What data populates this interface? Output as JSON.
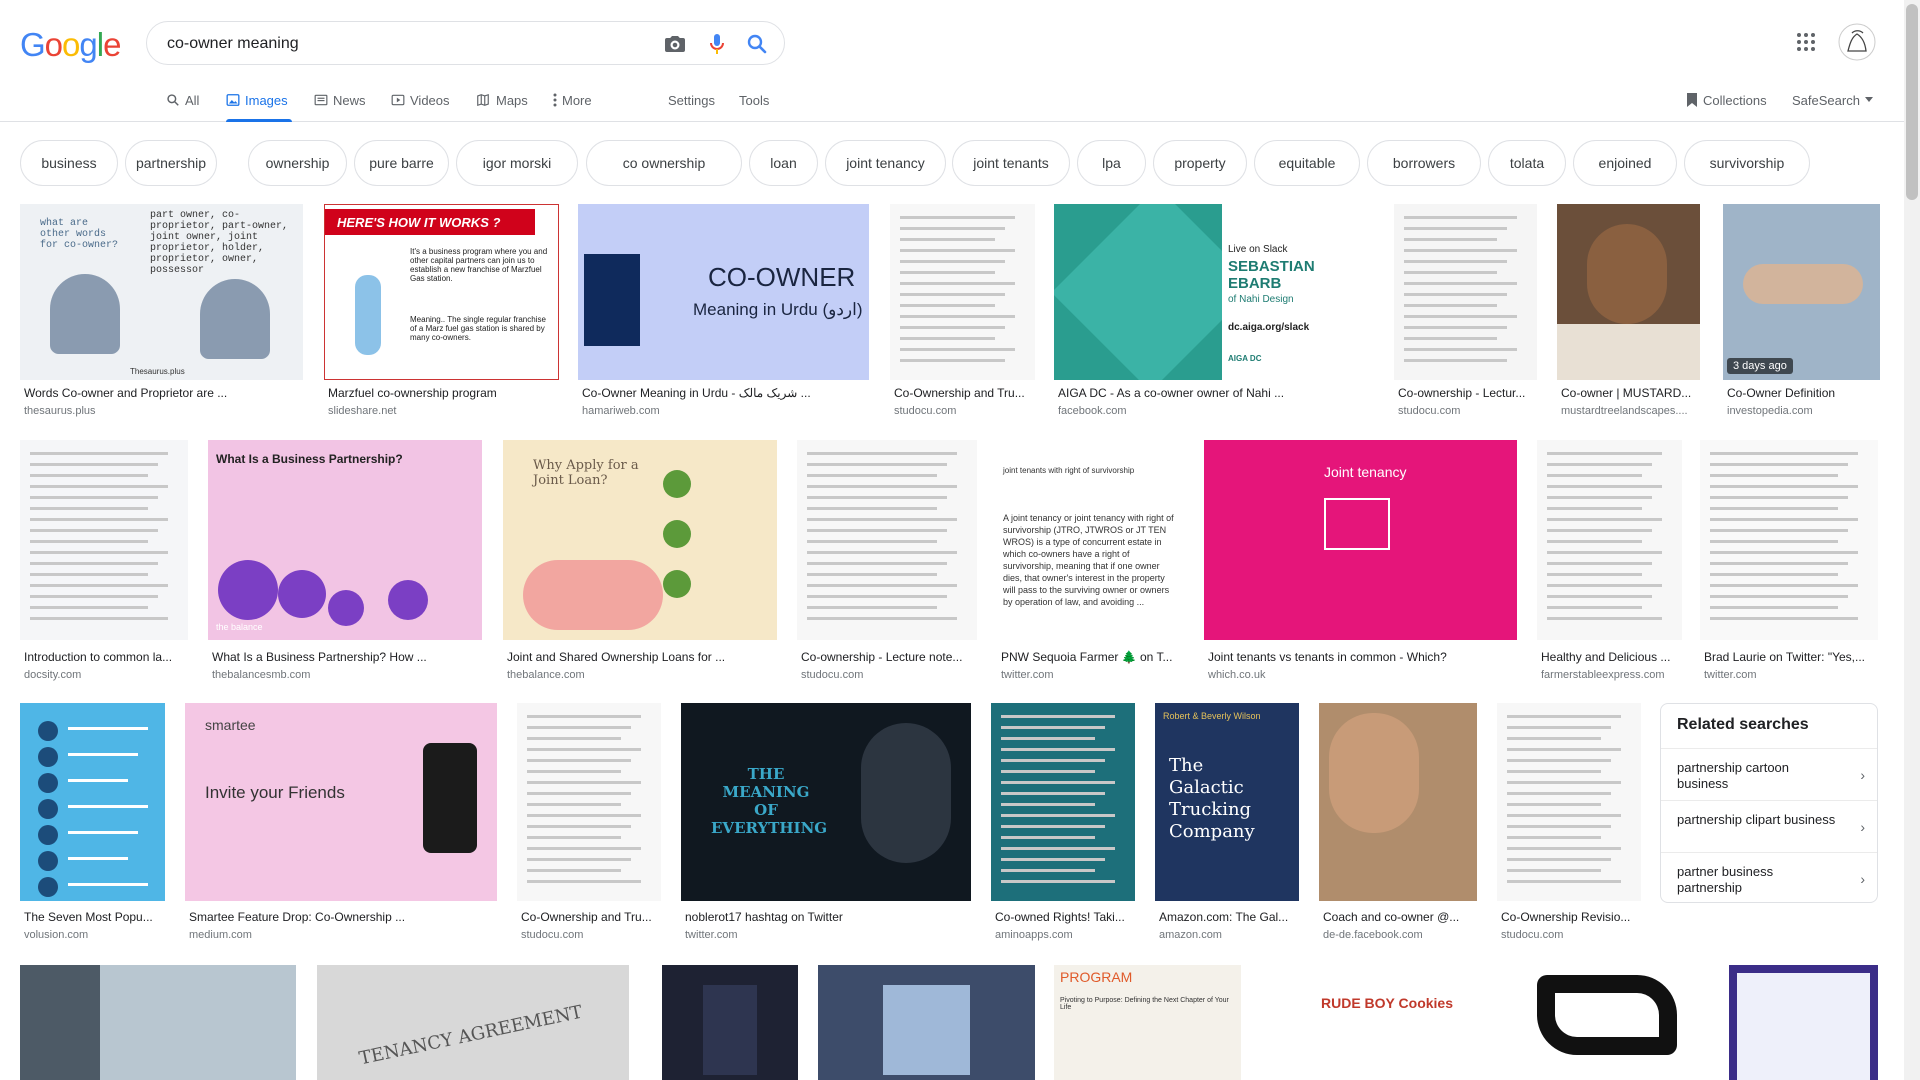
{
  "search": {
    "query": "co-owner meaning",
    "logo_letters": [
      {
        "ch": "G",
        "color": "#4285f4"
      },
      {
        "ch": "o",
        "color": "#ea4335"
      },
      {
        "ch": "o",
        "color": "#fbbc05"
      },
      {
        "ch": "g",
        "color": "#4285f4"
      },
      {
        "ch": "l",
        "color": "#34a853"
      },
      {
        "ch": "e",
        "color": "#ea4335"
      }
    ],
    "icons": [
      "camera-icon",
      "microphone-icon",
      "search-icon"
    ]
  },
  "tabs": {
    "all": "All",
    "images": "Images",
    "news": "News",
    "videos": "Videos",
    "maps": "Maps",
    "more": "More",
    "settings": "Settings",
    "tools": "Tools",
    "collections": "Collections",
    "safesearch": "SafeSearch"
  },
  "chips": [
    "business",
    "partnership",
    "ownership",
    "pure barre",
    "igor morski",
    "co ownership",
    "loan",
    "joint tenancy",
    "joint tenants",
    "lpa",
    "property",
    "equitable",
    "borrowers",
    "tolata",
    "enjoined",
    "survivorship"
  ],
  "results": {
    "row1": [
      {
        "title": "Words Co-owner and Proprietor are ...",
        "source": "thesaurus.plus",
        "color": "#eef1f4"
      },
      {
        "title": "Marzfuel co-ownership program",
        "source": "slideshare.net",
        "color": "#ffffff"
      },
      {
        "title": "Co-Owner Meaning in Urdu - شریک مالک ...",
        "source": "hamariweb.com",
        "color": "#c3cef7"
      },
      {
        "title": "Co-Ownership and Tru...",
        "source": "studocu.com",
        "color": "#f7f7f7"
      },
      {
        "title": "AIGA DC - As a co-owner owner of Nahi ...",
        "source": "facebook.com",
        "color": "#2a9d8f"
      },
      {
        "title": "Co-ownership - Lectur...",
        "source": "studocu.com",
        "color": "#f5f5f5"
      },
      {
        "title": "Co-owner | MUSTARD...",
        "source": "mustardtreelandscapes....",
        "color": "#6b4f3a"
      },
      {
        "title": "Co-Owner Definition",
        "source": "investopedia.com",
        "color": "#9fb4c8",
        "badge": "3 days ago"
      }
    ],
    "row2": [
      {
        "title": "Introduction to common la...",
        "source": "docsity.com",
        "color": "#f5f6f8"
      },
      {
        "title": "What Is a Business Partnership? How ...",
        "source": "thebalancesmb.com",
        "color": "#f2c4e4"
      },
      {
        "title": "Joint and Shared Ownership Loans for ...",
        "source": "thebalance.com",
        "color": "#f6e8c8"
      },
      {
        "title": "Co-ownership - Lecture note...",
        "source": "studocu.com",
        "color": "#f7f7f7"
      },
      {
        "title": "PNW Sequoia Farmer 🌲 on T...",
        "source": "twitter.com",
        "color": "#ffffff"
      },
      {
        "title": "Joint tenants vs tenants in common - Which?",
        "source": "which.co.uk",
        "color": "#e5157a"
      },
      {
        "title": "Healthy and Delicious ...",
        "source": "farmerstableexpress.com",
        "color": "#f7f7f7"
      },
      {
        "title": "Brad Laurie on Twitter: \"Yes,...",
        "source": "twitter.com",
        "color": "#f9f9f9"
      }
    ],
    "row3": [
      {
        "title": "The Seven Most Popu...",
        "source": "volusion.com",
        "color": "#4fb6e6"
      },
      {
        "title": "Smartee Feature Drop: Co-Ownership ...",
        "source": "medium.com",
        "color": "#f4c7e4"
      },
      {
        "title": "Co-Ownership and Tru...",
        "source": "studocu.com",
        "color": "#f7f7f7"
      },
      {
        "title": "noblerot17 hashtag on Twitter",
        "source": "twitter.com",
        "color": "#101820"
      },
      {
        "title": "Co-owned Rights! Taki...",
        "source": "aminoapps.com",
        "color": "#1d6f7a"
      },
      {
        "title": "Amazon.com: The Gal...",
        "source": "amazon.com",
        "color": "#1f3560"
      },
      {
        "title": "Coach and co-owner @...",
        "source": "de-de.facebook.com",
        "color": "#b08d6c"
      },
      {
        "title": "Co-Ownership Revisio...",
        "source": "studocu.com",
        "color": "#f7f7f7"
      }
    ],
    "row4": [
      {
        "color": "#4d5a66"
      },
      {
        "color": "#d8d8d8"
      },
      {
        "color": "#1e2233"
      },
      {
        "color": "#3d4c6a"
      },
      {
        "color": "#f4f1ea"
      },
      {
        "color": "#ffffff"
      },
      {
        "color": "#ffffff"
      },
      {
        "color": "#3b2d88"
      }
    ]
  },
  "thumb_texts": {
    "row1_1_a": "what are other words for co-owner?",
    "row1_1_b": "part owner, co-proprietor, part-owner, joint owner, joint proprietor, holder, proprietor, owner, possessor",
    "row1_1_c": "Thesaurus.plus",
    "row1_2_a": "HERE'S HOW IT WORKS ?",
    "row1_2_b": "It's a business program where you and other capital partners can join us to establish a new franchise of Marzfuel Gas station.",
    "row1_2_c": "Meaning.. The single regular franchise of a Marz fuel gas station is shared by many co-owners.",
    "row1_3_a": "CO-OWNER",
    "row1_3_b": "Meaning in Urdu (اردو)",
    "row1_5_a": "Live on Slack",
    "row1_5_b": "SEBASTIAN EBARB",
    "row1_5_c": "of Nahi Design",
    "row1_5_d": "dc.aiga.org/slack",
    "row1_5_e": "AIGA DC",
    "row2_2_a": "What Is a Business Partnership?",
    "row2_2_b": "the balance",
    "row2_3_a": "Why Apply for a Joint Loan?",
    "row2_5_a": "joint tenants with right of survivorship",
    "row2_5_b": "A joint tenancy or joint tenancy with right of survivorship (JTRO, JTWROS or JT TEN WROS) is a type of concurrent estate in which co-owners have a right of survivorship, meaning that if one owner dies, that owner's interest in the property will pass to the surviving owner or owners by operation of law, and avoiding ...",
    "row2_6_a": "Joint tenancy",
    "row3_2_a": "Invite your Friends",
    "row3_2_b": "smartee",
    "row3_4_a": "THE MEANING OF EVERYTHING",
    "row3_6_a": "Robert & Beverly Wilson",
    "row3_6_b": "The Galactic Trucking Company",
    "row4_6_a": "RUDE BOY Cookies",
    "row4_2_a": "TENANCY AGREEMENT",
    "row4_5_a": "PROGRAM",
    "row4_5_b": "Pivoting to Purpose: Defining the Next Chapter of Your Life"
  },
  "related": {
    "heading": "Related searches",
    "items": [
      "partnership cartoon business",
      "partnership clipart business",
      "partner business partnership"
    ]
  }
}
